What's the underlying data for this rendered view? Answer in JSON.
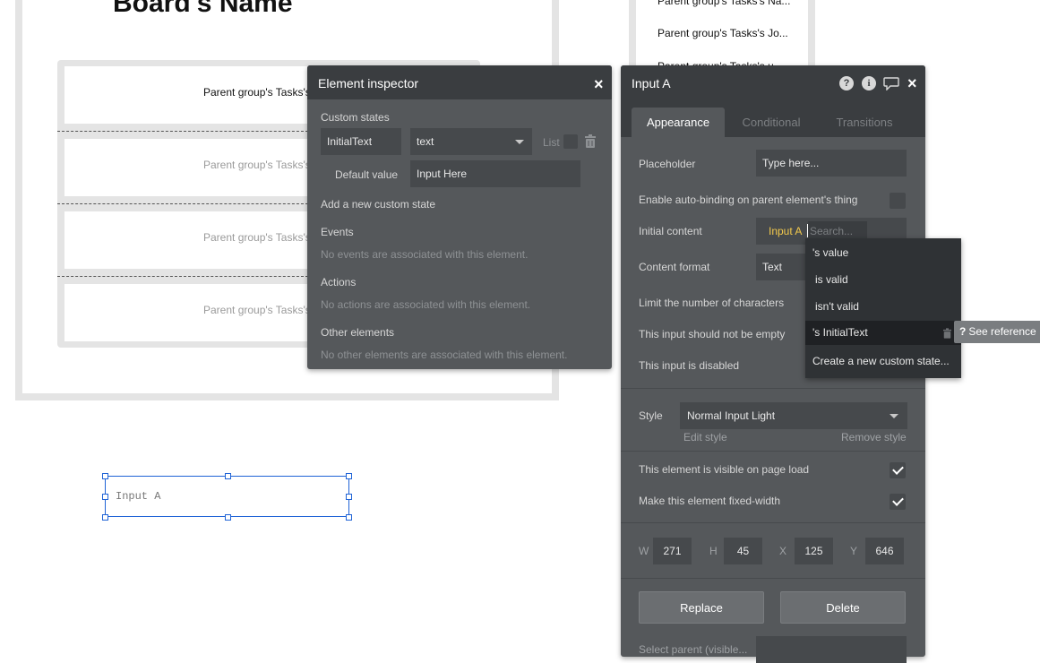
{
  "canvas": {
    "board_title": "Board's Name",
    "repeating_group": {
      "cells": [
        "Parent group's Tasks's Na",
        "Parent group's Tasks's",
        "Parent group's Tasks's",
        "Parent group's Tasks's"
      ]
    },
    "second_column": {
      "items": [
        "Parent group's Tasks's Na...",
        "Parent group's Tasks's Jo...",
        "Parent group's Tasks's u..."
      ]
    },
    "input_a": {
      "placeholder_text": "Input A"
    }
  },
  "element_inspector": {
    "title": "Element inspector",
    "custom_states": {
      "label": "Custom states",
      "state_name": "InitialText",
      "state_type": "text",
      "list_label": "List",
      "default_value_label": "Default value",
      "default_value": "Input Here",
      "add_state_label": "Add a new custom state"
    },
    "events": {
      "label": "Events",
      "empty": "No events are associated with this element."
    },
    "actions": {
      "label": "Actions",
      "empty": "No actions are associated with this element."
    },
    "other_elements": {
      "label": "Other elements",
      "empty": "No other elements are associated with this element."
    }
  },
  "property_editor": {
    "title": "Input A",
    "tabs": [
      "Appearance",
      "Conditional",
      "Transitions"
    ],
    "placeholder_label": "Placeholder",
    "placeholder_value": "Type here...",
    "auto_binding_label": "Enable auto-binding on parent element's thing",
    "initial_content_label": "Initial content",
    "initial_content_token": "Input A",
    "initial_content_search": "Search...",
    "content_format_label": "Content format",
    "content_format_value": "Text",
    "limit_chars_label": "Limit the number of characters",
    "not_empty_label": "This input should not be empty",
    "disabled_label": "This input is disabled",
    "style_label": "Style",
    "style_value": "Normal Input Light",
    "edit_style": "Edit style",
    "remove_style": "Remove style",
    "visible_label": "This element is visible on page load",
    "visible_checked": true,
    "fixed_width_label": "Make this element fixed-width",
    "fixed_width_checked": true,
    "dimensions": {
      "w_label": "W",
      "w": "271",
      "h_label": "H",
      "h": "45",
      "x_label": "X",
      "x": "125",
      "y_label": "Y",
      "y": "646"
    },
    "replace_button": "Replace",
    "delete_button": "Delete",
    "bottom_partial_label": "Select parent (visible..."
  },
  "dropdown": {
    "items": [
      "'s value",
      "is valid",
      "isn't valid",
      "'s InitialText",
      "Create a new custom state..."
    ],
    "highlighted_index": 3,
    "see_reference": "See reference"
  },
  "colors": {
    "panel_bg": "#55585b",
    "header_bg": "#3a3d40",
    "token_yellow": "#f2c94c",
    "selection_blue": "#1f63d6"
  }
}
